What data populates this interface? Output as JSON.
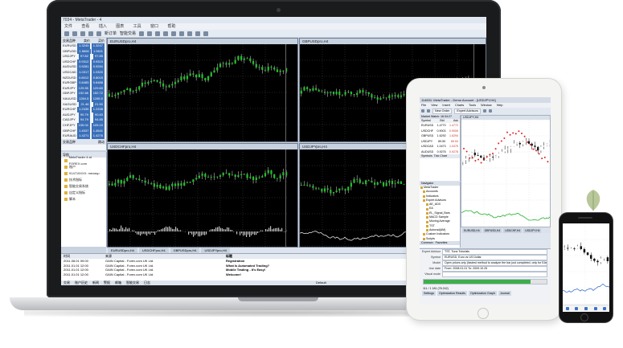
{
  "laptop": {
    "app_title": "7034 - MetaTrader - 4",
    "menu": [
      "文件",
      "查看",
      "插入",
      "图表",
      "工具",
      "窗口",
      "帮助"
    ],
    "toolbar": {
      "new_order_label": "新订单",
      "autotrading_label": "智能交易"
    },
    "market_watch": {
      "header": {
        "symbol": "交易品种",
        "bid": "卖价",
        "ask": "买价"
      },
      "rows": [
        {
          "symbol": "EURUSD",
          "bid": "1.3245",
          "ask": "1.3247"
        },
        {
          "symbol": "GBPUSD",
          "bid": "1.5608",
          "ask": "1.5611"
        },
        {
          "symbol": "USDJPY",
          "bid": "97.82",
          "ask": "97.85"
        },
        {
          "symbol": "USDCHF",
          "bid": "0.9312",
          "ask": "0.9315"
        },
        {
          "symbol": "AUDUSD",
          "bid": "0.9281",
          "ask": "0.9284"
        },
        {
          "symbol": "USDCAD",
          "bid": "1.0317",
          "ask": "1.0320"
        },
        {
          "symbol": "NZDUSD",
          "bid": "0.8012",
          "ask": "0.8015"
        },
        {
          "symbol": "EURGBP",
          "bid": "0.8485",
          "ask": "0.8488"
        },
        {
          "symbol": "EURJPY",
          "bid": "129.55",
          "ask": "129.60"
        },
        {
          "symbol": "GBPJPY",
          "bid": "152.66",
          "ask": "152.72"
        },
        {
          "symbol": "XAUUSD",
          "bid": "1284.5",
          "ask": "1285.0"
        },
        {
          "symbol": "XAGUSD",
          "bid": "21.46",
          "ask": "21.50"
        },
        {
          "symbol": "EURCHF",
          "bid": "1.2335",
          "ask": "1.2338"
        },
        {
          "symbol": "AUDJPY",
          "bid": "90.79",
          "ask": "90.83"
        },
        {
          "symbol": "CADJPY",
          "bid": "94.79",
          "ask": "94.85"
        },
        {
          "symbol": "CHFJPY",
          "bid": "105.04",
          "ask": "105.10"
        },
        {
          "symbol": "GBPCHF",
          "bid": "1.4537",
          "ask": "1.4541"
        },
        {
          "symbol": "EURAUD",
          "bid": "1.4271",
          "ask": "1.4276"
        }
      ],
      "tabs": [
        "交易品种",
        "跳动"
      ]
    },
    "navigator": {
      "title": "导航",
      "items": [
        "MetaTrader 4 at FOREX.com",
        "账户",
        "914715XXX: mexasp",
        "技术指标",
        "智能交易系统",
        "自定义指标",
        "脚本"
      ]
    },
    "charts": [
      {
        "title": "EURUSDpro,H4",
        "symbol": "EURUSDpro,H4",
        "indicator": "none"
      },
      {
        "title": "GBPUSDpro,H4",
        "symbol": "GBPUSDpro,H4",
        "indicator": "none"
      },
      {
        "title": "USDCHFpro,H4",
        "symbol": "USDCHFpro,H4",
        "indicator": "macd"
      },
      {
        "title": "USDJPYpro,H4",
        "symbol": "USDJPYpro,H4",
        "indicator": "line"
      }
    ],
    "chart_tabs": [
      "EURUSDpro,H4",
      "USDCHFpro,H4",
      "GBPUSDpro,H4",
      "USDJPYpro,H4"
    ],
    "news": {
      "header": {
        "time": "时间",
        "source": "来源",
        "title": "标题"
      },
      "rows": [
        {
          "time": "2011.08.01 09:00",
          "source": "GAIN Capital - Forex.com UK Ltd.",
          "title": "Registration"
        },
        {
          "time": "2011.01.01 12:00",
          "source": "GAIN Capital - Forex.com UK Ltd.",
          "title": "What Is Automated Trading?"
        },
        {
          "time": "2011.01.01 12:00",
          "source": "GAIN Capital - Forex.com UK Ltd.",
          "title": "Mobile Trading - It's Easy!"
        },
        {
          "time": "2011.01.01 12:00",
          "source": "GAIN Capital - Forex.com UK Ltd.",
          "title": "Welcome!"
        }
      ]
    },
    "terminal_tabs": [
      "交易",
      "账户历史",
      "新闻",
      "警报",
      "邮箱",
      "智能交易",
      "日志"
    ],
    "status": {
      "default": "Default"
    }
  },
  "tablet": {
    "app_title": "114831: MetaTrader - Demo Account - [USDJPY,H4]",
    "menu": [
      "File",
      "View",
      "Insert",
      "Charts",
      "Tools",
      "Window",
      "Help"
    ],
    "toolbar": {
      "new_order": "New Order",
      "expert_advisors": "Expert Advisors"
    },
    "market_watch": {
      "title": "Market Watch: 16:34:27",
      "header": {
        "symbol": "Symbol",
        "bid": "Bid",
        "ask": "Ask"
      },
      "rows": [
        {
          "symbol": "EURUSD",
          "bid": "1.4770",
          "ask": "1.4772"
        },
        {
          "symbol": "USDCHF",
          "bid": "0.9003",
          "ask": "0.9006"
        },
        {
          "symbol": "GBPUSD",
          "bid": "1.6292",
          "ask": "1.6294"
        },
        {
          "symbol": "USDJPY",
          "bid": "89.50",
          "ask": "89.53"
        },
        {
          "symbol": "USDCAD",
          "bid": "1.0473",
          "ask": "1.0475"
        },
        {
          "symbol": "AUDUSD",
          "bid": "0.9276",
          "ask": "0.9278"
        }
      ],
      "tabs": [
        "Symbols",
        "Tick Chart"
      ]
    },
    "navigator": {
      "title": "Navigator",
      "items": [
        "MetaTrader",
        "Accounts",
        "Indicators",
        "Expert Advisors",
        "AE_ADX",
        "EA",
        "EL_Signal_Bars",
        "MACD Sample",
        "Moving Average",
        "TST",
        "Autorad(AM)",
        "Custom Indicators",
        "Scripts"
      ],
      "tabs": [
        "Common",
        "Favorites"
      ]
    },
    "chart": {
      "title": "USDJPY,H4"
    },
    "chart_tabs": [
      "EURUSD,H4",
      "GBPUSD,H4",
      "USDCHF,H4",
      "USDJPY,H4"
    ],
    "tester": {
      "fields": [
        {
          "label": "Expert Advisor",
          "value": "TST, Tuna Tutorials"
        },
        {
          "label": "Symbol",
          "value": "EURUSD, Euro vs US Dollar"
        },
        {
          "label": "Model",
          "value": "Open prices only (fastest method to analyze the bar just completed, only for EAs that explicitly control bar opening)"
        },
        {
          "label": "Use date",
          "value": "From: 2008.01.01  To: 2009.10.25"
        },
        {
          "label": "Visual mode",
          "value": ""
        }
      ],
      "progress_fraction": 0.87,
      "progress_text": "111 / 1 181 (78.242)",
      "bottom_tabs": [
        "Settings",
        "Optimization Results",
        "Optimization Graph",
        "Journal"
      ]
    }
  },
  "phone": {
    "nav_icons": [
      "quotes-icon",
      "chart-icon",
      "trade-icon",
      "history-icon",
      "settings-icon"
    ]
  }
}
